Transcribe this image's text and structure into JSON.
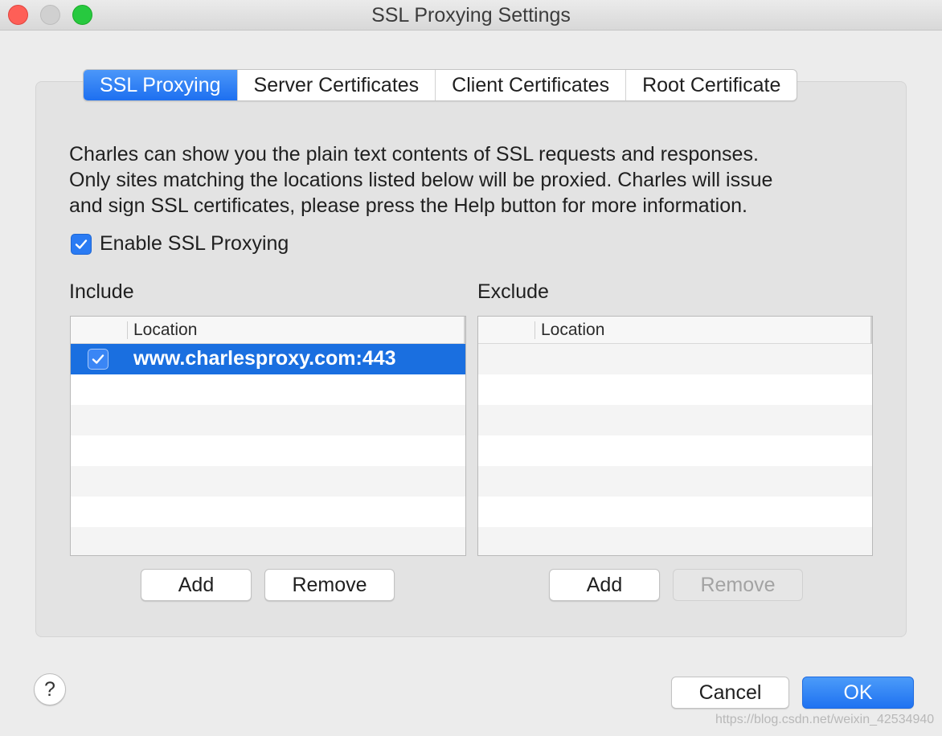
{
  "window": {
    "title": "SSL Proxying Settings"
  },
  "tabs": [
    {
      "label": "SSL Proxying",
      "active": true
    },
    {
      "label": "Server Certificates",
      "active": false
    },
    {
      "label": "Client Certificates",
      "active": false
    },
    {
      "label": "Root Certificate",
      "active": false
    }
  ],
  "description": {
    "line1": "Charles can show you the plain text contents of SSL requests and responses.",
    "line2": "Only sites matching the locations listed below will be proxied. Charles will issue",
    "line3": "and sign SSL certificates, please press the Help button for more information."
  },
  "enable": {
    "label": "Enable SSL Proxying",
    "checked": true
  },
  "include": {
    "label": "Include",
    "column": "Location",
    "rows": [
      {
        "checked": true,
        "location": "www.charlesproxy.com:443"
      }
    ],
    "add_label": "Add",
    "remove_label": "Remove"
  },
  "exclude": {
    "label": "Exclude",
    "column": "Location",
    "rows": [],
    "add_label": "Add",
    "remove_label": "Remove"
  },
  "footer": {
    "help_label": "?",
    "cancel_label": "Cancel",
    "ok_label": "OK",
    "watermark": "https://blog.csdn.net/weixin_42534940"
  },
  "colors": {
    "accent": "#1d6ff0",
    "selection": "#1a6fe0",
    "close": "#fe5f57",
    "maximize": "#27c93f"
  }
}
